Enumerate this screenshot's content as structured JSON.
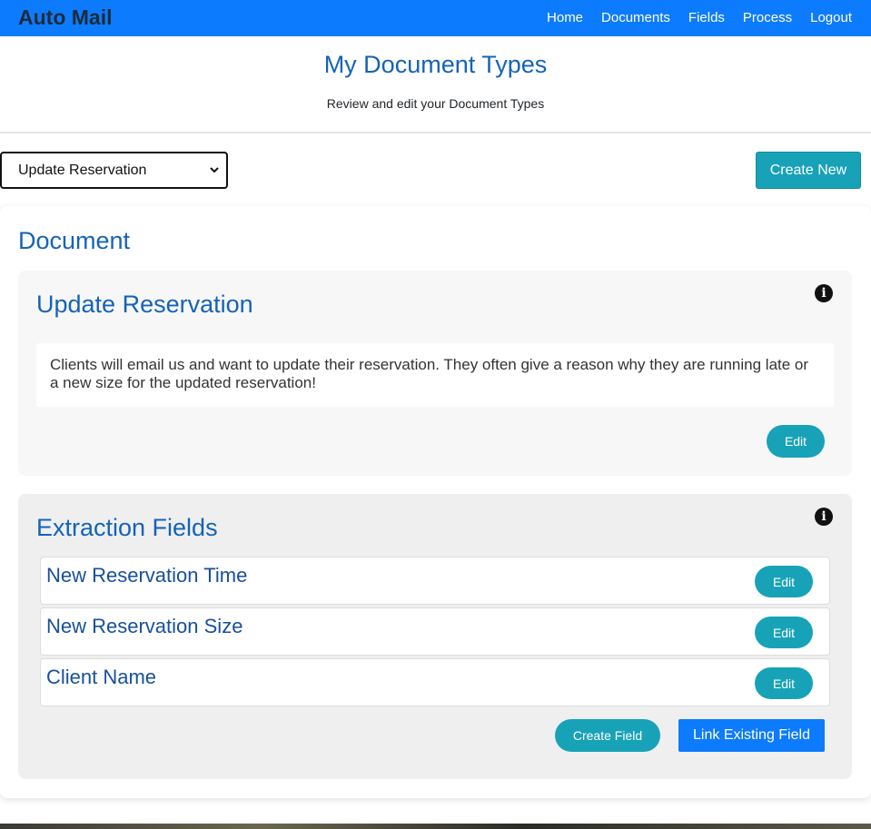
{
  "app": {
    "brand": "Auto Mail"
  },
  "nav": {
    "items": [
      "Home",
      "Documents",
      "Fields",
      "Process",
      "Logout"
    ]
  },
  "header": {
    "title": "My Document Types",
    "subtitle": "Review and edit your Document Types"
  },
  "toolbar": {
    "selected_document": "Update Reservation",
    "create_new_label": "Create New"
  },
  "document_section": {
    "title": "Document",
    "card": {
      "title": "Update Reservation",
      "description": "Clients will email us and want to update their reservation. They often give a reason why they are running late or a new size for the updated reservation!",
      "edit_label": "Edit",
      "info_icon": "info-icon"
    }
  },
  "extraction": {
    "title": "Extraction Fields",
    "info_icon": "info-icon",
    "fields": [
      {
        "name": "New Reservation Time",
        "edit_label": "Edit"
      },
      {
        "name": "New Reservation Size",
        "edit_label": "Edit"
      },
      {
        "name": "Client Name",
        "edit_label": "Edit"
      }
    ],
    "create_field_label": "Create Field",
    "link_existing_label": "Link Existing Field"
  },
  "colors": {
    "navbar": "#0d7bfd",
    "title_blue": "#1563b8",
    "teal_button": "#18a2b8",
    "primary_button": "#0d7bfd"
  }
}
